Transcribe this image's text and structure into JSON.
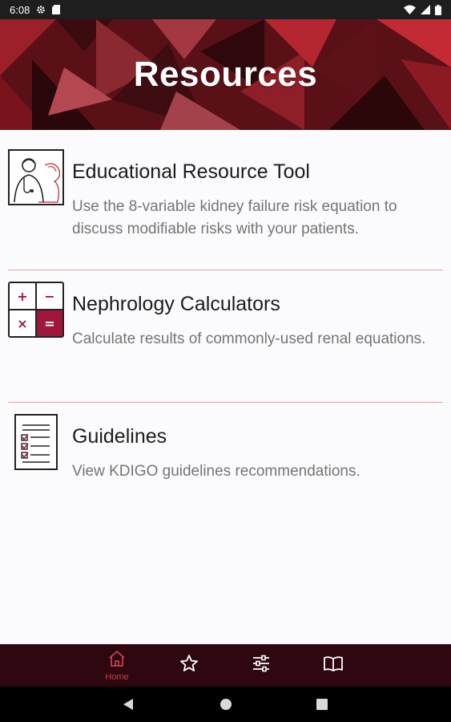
{
  "status_bar": {
    "time": "6:08",
    "left_icons": [
      "gear-icon",
      "sd-card-icon"
    ],
    "right_icons": [
      "wifi-icon",
      "cellular-icon",
      "battery-icon"
    ]
  },
  "header": {
    "title": "Resources",
    "colors": {
      "primary": "#8b1a23",
      "dark": "#2b0a0e",
      "light": "#a9434a"
    }
  },
  "resources": [
    {
      "title": "Educational Resource Tool",
      "description": "Use the 8-variable kidney failure risk equation to discuss modifiable risks with your patients.",
      "icon": "doctor-patient-icon"
    },
    {
      "title": "Nephrology Calculators",
      "description": "Calculate results of commonly-used renal equations.",
      "icon": "calculator-icon",
      "calc_symbols": [
        "+",
        "−",
        "×",
        "="
      ]
    },
    {
      "title": "Guidelines",
      "description": "View KDIGO guidelines recommendations.",
      "icon": "checklist-icon"
    }
  ],
  "bottom_nav": {
    "items": [
      {
        "label": "Home",
        "icon": "home-icon",
        "active": true
      },
      {
        "label": "",
        "icon": "star-icon",
        "active": false
      },
      {
        "label": "",
        "icon": "sliders-icon",
        "active": false
      },
      {
        "label": "",
        "icon": "book-icon",
        "active": false
      }
    ],
    "active_color": "#c2434c",
    "inactive_color": "#ffffff"
  },
  "system_nav": [
    "back-icon",
    "home-circle-icon",
    "recents-icon"
  ]
}
